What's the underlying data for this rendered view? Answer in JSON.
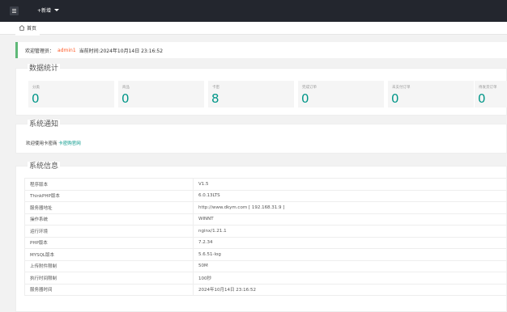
{
  "topbar": {
    "add_label": "+新增"
  },
  "tabs": [
    {
      "label": "首页"
    }
  ],
  "welcome": {
    "prefix": "欢迎管理员：",
    "username": "admin1",
    "time_text": "当前时间:2024年10月14日 23:16:52"
  },
  "stats_panel": {
    "title": "数据统计",
    "items": [
      {
        "label": "分类",
        "value": "0"
      },
      {
        "label": "商品",
        "value": "0"
      },
      {
        "label": "卡密",
        "value": "8"
      },
      {
        "label": "完成订单",
        "value": "0"
      },
      {
        "label": "未支付订单",
        "value": "0"
      },
      {
        "label": "待发货订单",
        "value": "0"
      }
    ]
  },
  "notify_panel": {
    "title": "系统通知",
    "text": "欢迎使用卡密商",
    "link": "卡密购官网"
  },
  "info_panel": {
    "title": "系统信息",
    "rows": [
      {
        "key": "程序版本",
        "value": "V1.5"
      },
      {
        "key": "ThinkPHP版本",
        "value": "6.0.13LTS"
      },
      {
        "key": "服务器地址",
        "value": "http://www.dkym.com [ 192.168.31.9 ]"
      },
      {
        "key": "操作系统",
        "value": "WINNT"
      },
      {
        "key": "运行环境",
        "value": "nginx/1.21.1"
      },
      {
        "key": "PHP版本",
        "value": "7.2.34"
      },
      {
        "key": "MYSQL版本",
        "value": "5.6.51-log"
      },
      {
        "key": "上传附件限制",
        "value": "50M"
      },
      {
        "key": "执行时间限制",
        "value": "100秒"
      },
      {
        "key": "服务器时间",
        "value": "2024年10月14日 23:16:52"
      }
    ]
  }
}
